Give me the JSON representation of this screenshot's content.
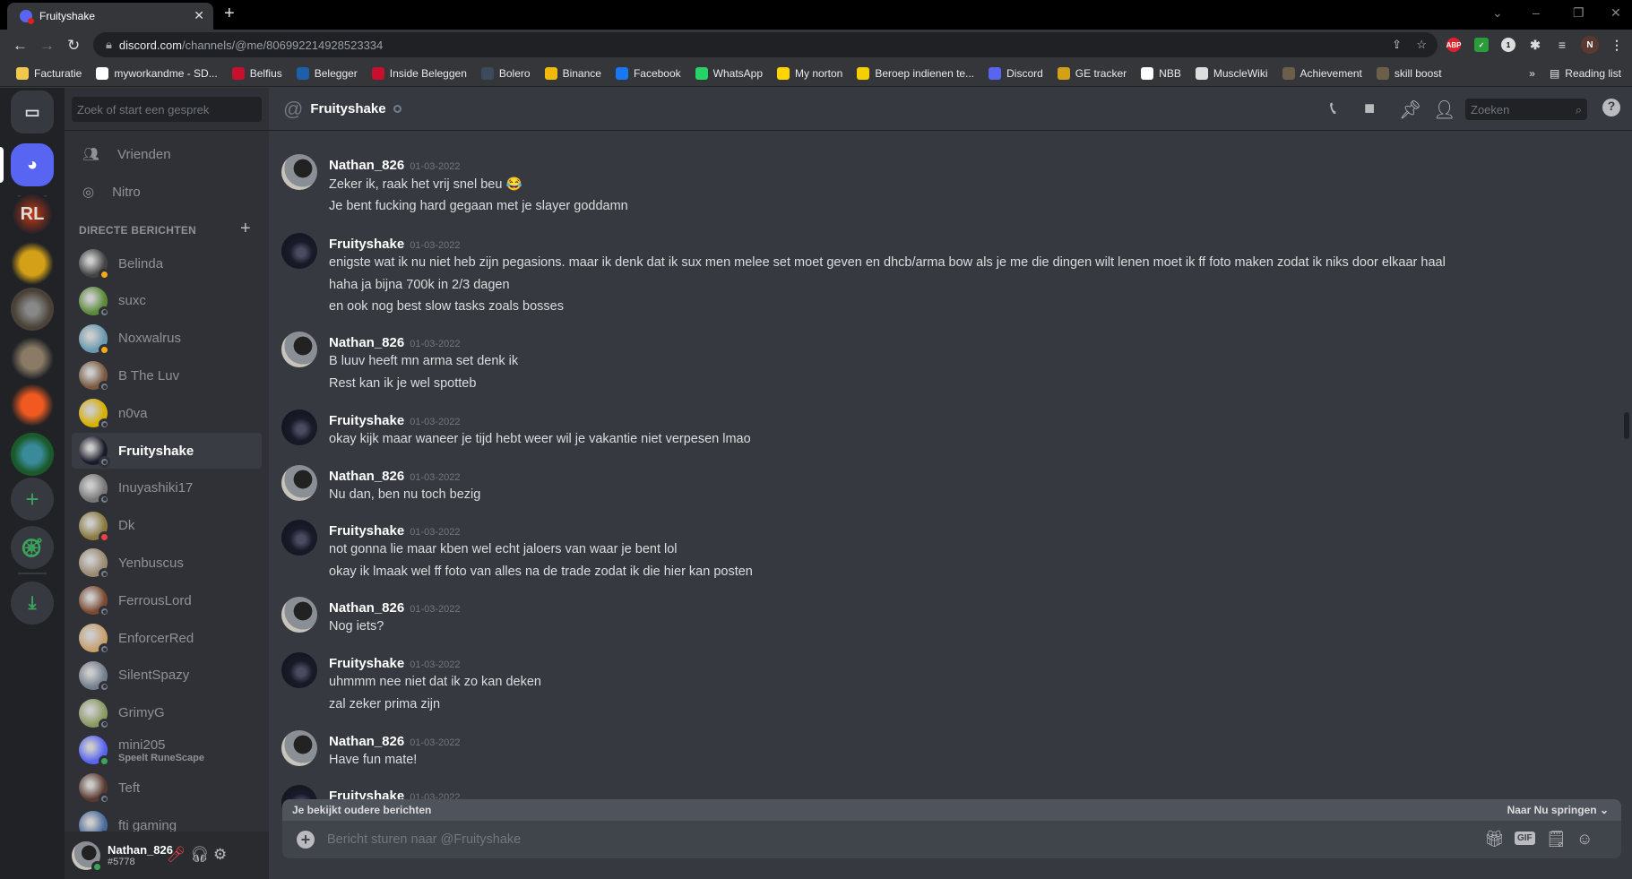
{
  "browser": {
    "tab_title": "Fruityshake",
    "url_host": "discord.com",
    "url_path": "/channels/@me/806992214928523334",
    "bookmarks": [
      {
        "label": "Facturatie",
        "color": "#f2c94c"
      },
      {
        "label": "myworkandme - SD...",
        "color": "#ffffff"
      },
      {
        "label": "Belfius",
        "color": "#c8102e"
      },
      {
        "label": "Belegger",
        "color": "#1f5fa8"
      },
      {
        "label": "Inside Beleggen",
        "color": "#c8102e"
      },
      {
        "label": "Bolero",
        "color": "#3b4a5c"
      },
      {
        "label": "Binance",
        "color": "#f0b90b"
      },
      {
        "label": "Facebook",
        "color": "#1877f2"
      },
      {
        "label": "WhatsApp",
        "color": "#25d366"
      },
      {
        "label": "My norton",
        "color": "#ffd400"
      },
      {
        "label": "Beroep indienen te...",
        "color": "#f5d000"
      },
      {
        "label": "Discord",
        "color": "#5865f2"
      },
      {
        "label": "GE tracker",
        "color": "#d4a017"
      },
      {
        "label": "NBB",
        "color": "#ffffff"
      },
      {
        "label": "MuscleWiki",
        "color": "#dddddd"
      },
      {
        "label": "Achievement",
        "color": "#6b5e4a"
      },
      {
        "label": "skill boost",
        "color": "#6b5e4a"
      }
    ],
    "more_bookmarks": "»",
    "reading_list": "Reading list",
    "profile_initial": "N",
    "abp_label": "ABP",
    "ext_badge": "1"
  },
  "sidebar": {
    "search_placeholder": "Zoek of start een gesprek",
    "friends": "Vrienden",
    "nitro": "Nitro",
    "dm_header": "DIRECTE BERICHTEN",
    "dms": [
      {
        "name": "Belinda",
        "status": "idle",
        "color": "#444"
      },
      {
        "name": "suxc",
        "status": "offline",
        "color": "#5a8a3a"
      },
      {
        "name": "Noxwalrus",
        "status": "idle",
        "color": "#6a9ab0"
      },
      {
        "name": "B The Luv",
        "status": "offline",
        "color": "#7a5a40"
      },
      {
        "name": "n0va",
        "status": "offline",
        "color": "#d8b000"
      },
      {
        "name": "Fruityshake",
        "status": "offline",
        "color": "#1a1b2a",
        "selected": true
      },
      {
        "name": "Inuyashiki17",
        "status": "offline",
        "color": "#777"
      },
      {
        "name": "Dk",
        "status": "dnd",
        "color": "#8a7a40"
      },
      {
        "name": "Yenbuscus",
        "status": "offline",
        "color": "#9a8a70"
      },
      {
        "name": "FerrousLord",
        "status": "offline",
        "color": "#7a4a30"
      },
      {
        "name": "EnforcerRed",
        "status": "offline",
        "color": "#c8a070"
      },
      {
        "name": "SilentSpazy",
        "status": "offline",
        "color": "#747f8d"
      },
      {
        "name": "GrimyG",
        "status": "offline",
        "color": "#8a9a60"
      },
      {
        "name": "mini205",
        "status": "online",
        "color": "#5865f2",
        "activity": "Speelt RuneScape"
      },
      {
        "name": "Teft",
        "status": "offline",
        "color": "#5a3a30"
      },
      {
        "name": "fti gaming",
        "status": "offline",
        "color": "#4a6a9a"
      }
    ]
  },
  "user": {
    "name": "Nathan_826",
    "tag": "#5778",
    "status": "online"
  },
  "chat": {
    "recipient": "Fruityshake",
    "search_placeholder": "Zoeken",
    "groups": [
      {
        "author": "Nathan_826",
        "time": "01-03-2022",
        "lines": [
          "Zeker ik, raak het vrij snel beu 😂",
          "Je bent fucking hard gegaan met je slayer goddamn"
        ]
      },
      {
        "author": "Fruityshake",
        "time": "01-03-2022",
        "lines": [
          "enigste wat ik nu niet heb zijn pegasions. maar ik denk dat ik sux men melee set moet geven en dhcb/arma bow als je me die dingen wilt lenen moet ik ff foto maken zodat ik niks door elkaar haal",
          "haha ja bijna 700k in 2/3 dagen",
          "en ook nog best slow tasks zoals bosses"
        ]
      },
      {
        "author": "Nathan_826",
        "time": "01-03-2022",
        "lines": [
          "B luuv heeft mn arma set denk ik",
          "Rest kan ik je wel spotteb"
        ]
      },
      {
        "author": "Fruityshake",
        "time": "01-03-2022",
        "lines": [
          "okay kijk maar waneer je tijd hebt weer wil je vakantie niet verpesen lmao"
        ]
      },
      {
        "author": "Nathan_826",
        "time": "01-03-2022",
        "lines": [
          "Nu dan, ben nu toch bezig"
        ]
      },
      {
        "author": "Fruityshake",
        "time": "01-03-2022",
        "lines": [
          "not gonna lie maar kben wel echt jaloers van waar je bent lol",
          "okay ik lmaak wel ff foto van alles na de trade zodat ik die hier kan posten"
        ]
      },
      {
        "author": "Nathan_826",
        "time": "01-03-2022",
        "lines": [
          "Nog iets?"
        ]
      },
      {
        "author": "Fruityshake",
        "time": "01-03-2022",
        "lines": [
          "uhmmm nee niet dat ik zo kan deken",
          "zal zeker prima zijn"
        ]
      },
      {
        "author": "Nathan_826",
        "time": "01-03-2022",
        "lines": [
          "Have fun mate!"
        ]
      },
      {
        "author": "Fruityshake",
        "time": "01-03-2022",
        "lines": []
      }
    ],
    "older_notice": "Je bekijkt oudere berichten",
    "jump_label": "Naar Nu springen",
    "input_placeholder": "Bericht sturen naar @Fruityshake",
    "gif_label": "GIF"
  },
  "colors": {
    "blurple": "#5865f2",
    "green": "#3ba55d"
  }
}
